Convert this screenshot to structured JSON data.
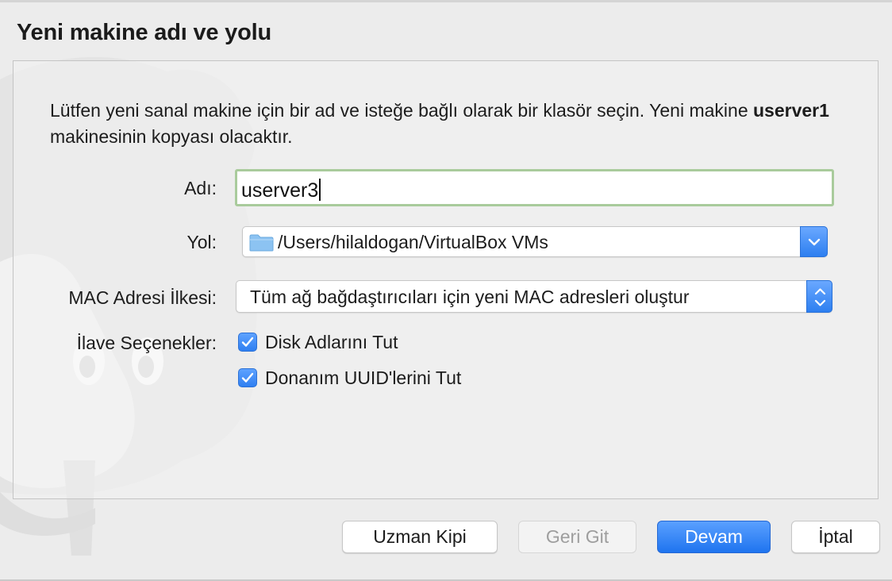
{
  "dialog": {
    "title": "Yeni makine adı ve yolu",
    "description_part1": "Lütfen yeni sanal makine için bir ad ve isteğe bağlı olarak bir klasör seçin. Yeni makine ",
    "description_bold": "userver1",
    "description_part2": " makinesinin kopyası olacaktır."
  },
  "form": {
    "name_label": "Adı:",
    "name_value": "userver3",
    "path_label": "Yol:",
    "path_value": "/Users/hilaldogan/VirtualBox VMs",
    "mac_label": "MAC Adresi İlkesi:",
    "mac_value": "Tüm ağ bağdaştırıcıları için yeni MAC adresleri oluştur",
    "options_label": "İlave Seçenekler:",
    "options": [
      {
        "label": "Disk Adlarını Tut",
        "checked": true
      },
      {
        "label": "Donanım UUID'lerini Tut",
        "checked": true
      }
    ]
  },
  "buttons": {
    "expert": "Uzman Kipi",
    "back": "Geri Git",
    "continue": "Devam",
    "cancel": "İptal"
  },
  "colors": {
    "accent": "#2f7ff1",
    "input_focus_border": "#a9cb9c",
    "folder": "#8cc3f2"
  }
}
